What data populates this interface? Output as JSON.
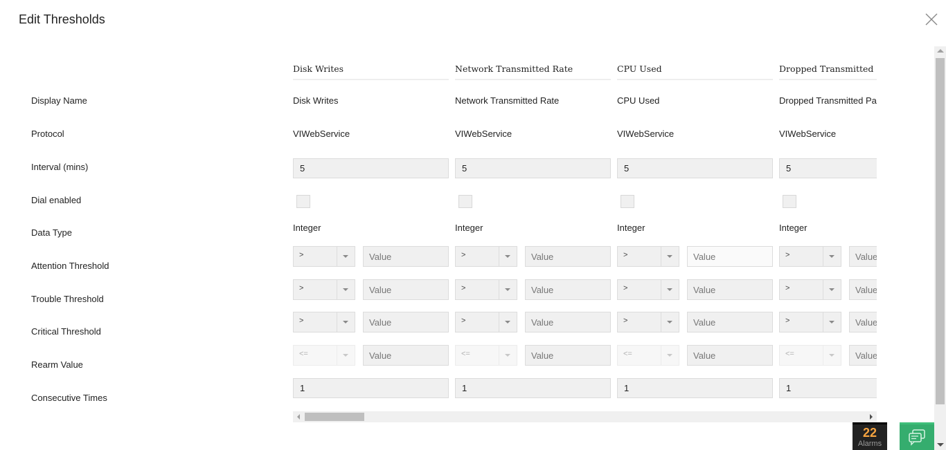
{
  "dialog": {
    "title": "Edit Thresholds",
    "close_icon": "close-icon"
  },
  "row_labels": [
    "Display Name",
    "Protocol",
    "Interval (mins)",
    "Dial enabled",
    "Data Type",
    "Attention Threshold",
    "Trouble Threshold",
    "Critical Threshold",
    "Rearm Value",
    "Consecutive Times"
  ],
  "columns": [
    {
      "header": "Disk Writes",
      "display_name": "Disk Writes",
      "protocol": "VIWebService",
      "interval": "5",
      "dial_enabled": false,
      "data_type": "Integer",
      "attention": {
        "operator": ">",
        "value_placeholder": "Value"
      },
      "trouble": {
        "operator": ">",
        "value_placeholder": "Value"
      },
      "critical": {
        "operator": ">",
        "value_placeholder": "Value"
      },
      "rearm": {
        "operator": "<=",
        "value_placeholder": "Value"
      },
      "consecutive_times": "1"
    },
    {
      "header": "Network Transmitted Rate",
      "display_name": "Network Transmitted Rate",
      "protocol": "VIWebService",
      "interval": "5",
      "dial_enabled": false,
      "data_type": "Integer",
      "attention": {
        "operator": ">",
        "value_placeholder": "Value"
      },
      "trouble": {
        "operator": ">",
        "value_placeholder": "Value"
      },
      "critical": {
        "operator": ">",
        "value_placeholder": "Value"
      },
      "rearm": {
        "operator": "<=",
        "value_placeholder": "Value"
      },
      "consecutive_times": "1"
    },
    {
      "header": "CPU Used",
      "display_name": "CPU Used",
      "protocol": "VIWebService",
      "interval": "5",
      "dial_enabled": false,
      "data_type": "Integer",
      "attention": {
        "operator": ">",
        "value_placeholder": "Value"
      },
      "trouble": {
        "operator": ">",
        "value_placeholder": "Value"
      },
      "critical": {
        "operator": ">",
        "value_placeholder": "Value"
      },
      "rearm": {
        "operator": "<=",
        "value_placeholder": "Value"
      },
      "consecutive_times": "1"
    },
    {
      "header": "Dropped Transmitted P",
      "display_name": "Dropped Transmitted Pac",
      "protocol": "VIWebService",
      "interval": "5",
      "dial_enabled": false,
      "data_type": "Integer",
      "attention": {
        "operator": ">",
        "value_placeholder": "Value"
      },
      "trouble": {
        "operator": ">",
        "value_placeholder": "Value"
      },
      "critical": {
        "operator": ">",
        "value_placeholder": "Value"
      },
      "rearm": {
        "operator": "<=",
        "value_placeholder": "Value"
      },
      "consecutive_times": "1"
    }
  ],
  "footer": {
    "alarms_count": "22",
    "alarms_label": "Alarms",
    "chat_icon": "chat-icon"
  },
  "colors": {
    "alarm_count": "#f7a440",
    "chat_bg": "#35ad6e",
    "input_bg": "#f0f0f0"
  }
}
